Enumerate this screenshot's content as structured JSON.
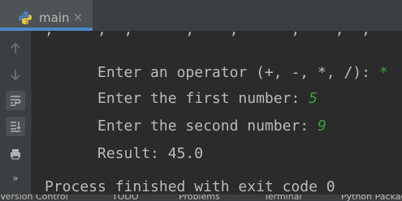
{
  "tab": {
    "label": "main",
    "close_glyph": "×",
    "icon": "python-file-icon"
  },
  "gutter": {
    "buttons": [
      {
        "name": "rerun-up-icon",
        "glyph": "↑"
      },
      {
        "name": "down-arrow-icon",
        "glyph": "↓"
      },
      {
        "name": "soft-wrap-icon",
        "glyph": "wrap"
      },
      {
        "name": "scroll-to-end-icon",
        "glyph": "end"
      },
      {
        "name": "print-icon",
        "glyph": "print"
      },
      {
        "name": "more-icon",
        "glyph": "»"
      }
    ]
  },
  "console": {
    "top_partial": ",     ,  ,      ,    ,      ,    ,  ,",
    "lines": [
      {
        "prompt": "Enter an operator (+, -, *, /): ",
        "input": "*"
      },
      {
        "prompt": "Enter the first number: ",
        "input": "5"
      },
      {
        "prompt": "Enter the second number: ",
        "input": "9"
      },
      {
        "prompt": "Result: 45.0",
        "input": ""
      }
    ],
    "exit_line": "Process finished with exit code 0"
  },
  "statusbar": {
    "items": [
      "Version Control",
      "TODO",
      "Problems",
      "Terminal",
      "Python Packages"
    ]
  },
  "colors": {
    "background": "#2b2b2b",
    "toolbar": "#3c3f41",
    "text": "#bbbbbb",
    "input": "#3d9f3d",
    "tab_accent": "#4a88c7"
  }
}
